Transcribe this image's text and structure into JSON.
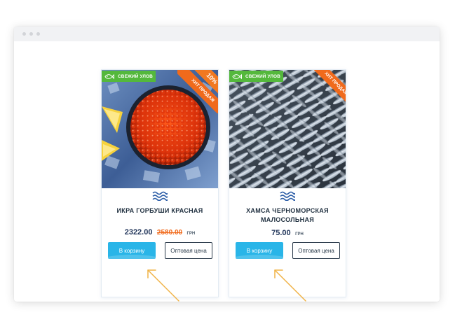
{
  "products": [
    {
      "badge": "СВЕЖИЙ УЛОВ",
      "ribbon": "ХИТ ПРОДАЖ",
      "discount": "10%",
      "title": "ИКРА ГОРБУШИ КРАСНАЯ",
      "price": "2322.00",
      "old_price": "2580.00",
      "currency": "ГРН",
      "cart_button": "В корзину",
      "wholesale_button": "Оптовая цена"
    },
    {
      "badge": "СВЕЖИЙ УЛОВ",
      "ribbon": "ХИТ ПРОДАЖ",
      "title": "ХАМСА ЧЕРНОМОРСКАЯ МАЛОСОЛЬНАЯ",
      "price": "75.00",
      "currency": "ГРН",
      "cart_button": "В корзину",
      "wholesale_button": "Оптовая цена"
    }
  ],
  "colors": {
    "badge_green": "#54b83c",
    "ribbon_orange": "#f06a1c",
    "cart_blue": "#29b5e8",
    "price_navy": "#21355a",
    "arrow": "#f0b347"
  },
  "icons": [
    "fish-icon",
    "waves-icon",
    "arrow-icon"
  ]
}
